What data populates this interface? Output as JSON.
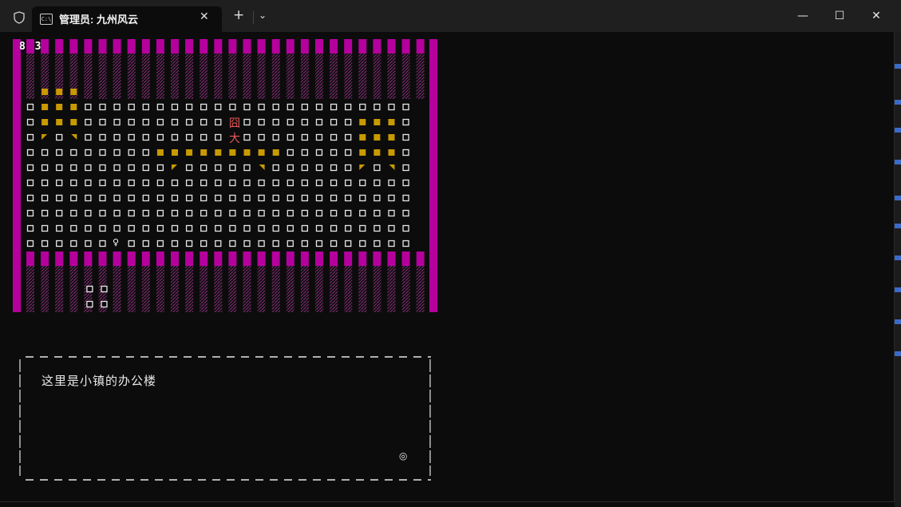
{
  "window": {
    "tab_title": "管理员: 九州风云",
    "tab_icon": "terminal-icon",
    "close_tab_glyph": "✕",
    "new_tab_glyph": "+",
    "dropdown_glyph": "⌄",
    "minimize_glyph": "—",
    "maximize_glyph": "☐",
    "close_glyph": "✕"
  },
  "game": {
    "coords": "8 3",
    "map_chars": [
      "囧",
      "大"
    ],
    "hero_glyph": "♀",
    "colors": {
      "wall": "#b5009e",
      "furniture": "#c99a00",
      "floor": "#e6e6e6",
      "npc": "#e85a5a"
    }
  },
  "dialog": {
    "text": "这里是小镇的办公楼",
    "cursor_glyph": "◎"
  }
}
